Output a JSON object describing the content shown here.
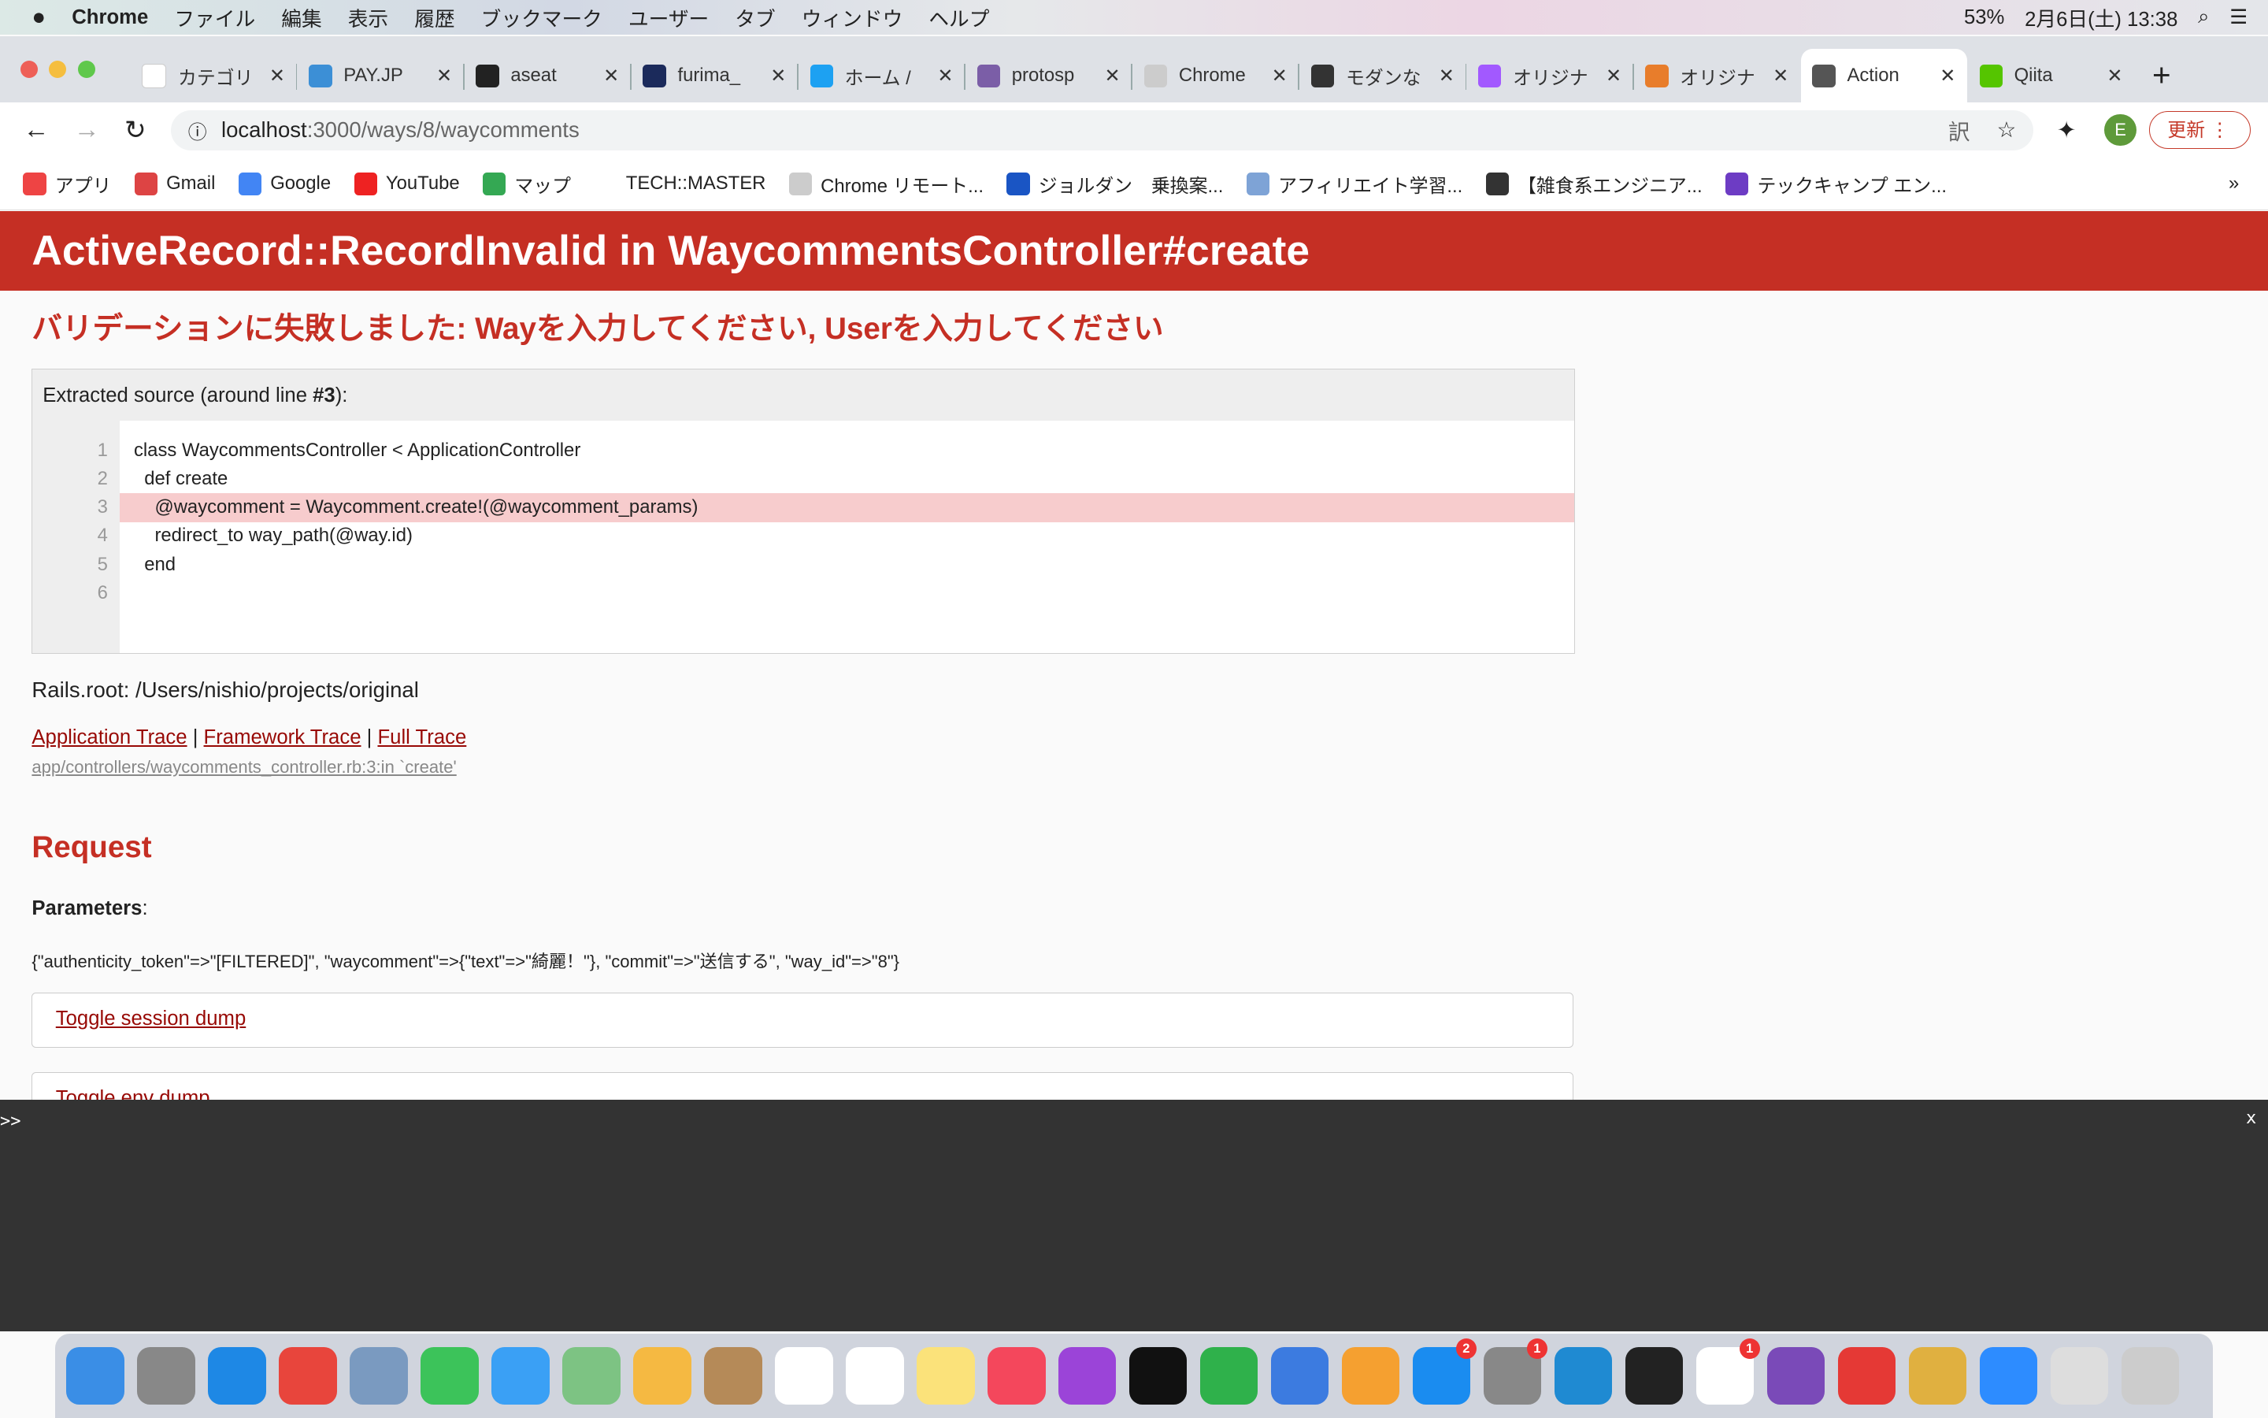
{
  "menubar": {
    "app": "Chrome",
    "items": [
      "ファイル",
      "編集",
      "表示",
      "履歴",
      "ブックマーク",
      "ユーザー",
      "タブ",
      "ウィンドウ",
      "ヘルプ"
    ],
    "battery": "53%",
    "clock": "2月6日(土) 13:38"
  },
  "tabs": [
    {
      "label": "カテゴリ",
      "color": "#fff"
    },
    {
      "label": "PAY.JP",
      "color": "#3c8fd6"
    },
    {
      "label": "aseat",
      "color": "#222"
    },
    {
      "label": "furima_",
      "color": "#1b2a5b"
    },
    {
      "label": "ホーム /",
      "color": "#1da1f2"
    },
    {
      "label": "protosp",
      "color": "#7b5ea7"
    },
    {
      "label": "Chrome",
      "color": "#ccc"
    },
    {
      "label": "モダンな",
      "color": "#333"
    },
    {
      "label": "オリジナ",
      "color": "#a259ff"
    },
    {
      "label": "オリジナ",
      "color": "#e87d2b"
    },
    {
      "label": "Action",
      "color": "#555",
      "active": true
    },
    {
      "label": "Qiita",
      "color": "#55c500"
    }
  ],
  "address": {
    "host": "localhost",
    "path": ":3000/ways/8/waycomments"
  },
  "profile_initial": "E",
  "update_label": "更新",
  "bookmarks": [
    {
      "label": "アプリ",
      "color": "#e44"
    },
    {
      "label": "Gmail",
      "color": "#d44"
    },
    {
      "label": "Google",
      "color": "#4285f4"
    },
    {
      "label": "YouTube",
      "color": "#e22"
    },
    {
      "label": "マップ",
      "color": "#34a853"
    },
    {
      "label": "TECH::MASTER",
      "color": "#fff"
    },
    {
      "label": "Chrome リモート...",
      "color": "#ccc"
    },
    {
      "label": "ジョルダン　乗換案...",
      "color": "#1a55c4"
    },
    {
      "label": "アフィリエイト学習...",
      "color": "#7ea3d6"
    },
    {
      "label": "【雑食系エンジニア...",
      "color": "#333"
    },
    {
      "label": "テックキャンプ エン...",
      "color": "#6d3cc4"
    }
  ],
  "error": {
    "title": "ActiveRecord::RecordInvalid in WaycommentsController#create",
    "message": "バリデーションに失敗しました: Wayを入力してください, Userを入力してください",
    "source_caption_pre": "Extracted source (around line ",
    "source_caption_line": "#3",
    "source_caption_post": "):",
    "lines": [
      {
        "n": "1",
        "code": "class WaycommentsController < ApplicationController"
      },
      {
        "n": "2",
        "code": "  def create"
      },
      {
        "n": "3",
        "code": "    @waycomment = Waycomment.create!(@waycomment_params)",
        "hl": true
      },
      {
        "n": "4",
        "code": "    redirect_to way_path(@way.id)"
      },
      {
        "n": "5",
        "code": "  end"
      },
      {
        "n": "6",
        "code": ""
      }
    ],
    "rails_root": "Rails.root: /Users/nishio/projects/original",
    "trace_links": [
      "Application Trace",
      "Framework Trace",
      "Full Trace"
    ],
    "trace_line": "app/controllers/waycomments_controller.rb:3:in `create'",
    "request_heading": "Request",
    "params_label": "Parameters",
    "params": "{\"authenticity_token\"=>\"[FILTERED]\", \"waycomment\"=>{\"text\"=>\"綺麗！\"}, \"commit\"=>\"送信する\", \"way_id\"=>\"8\"}",
    "toggle_session": "Toggle session dump",
    "toggle_env": "Toggle env dump"
  },
  "console": {
    "prompt": ">>",
    "close": "x"
  },
  "dock": [
    {
      "name": "finder",
      "color": "#3a8ee6"
    },
    {
      "name": "launchpad",
      "color": "#888"
    },
    {
      "name": "safari",
      "color": "#1e88e5"
    },
    {
      "name": "chrome",
      "color": "#e8453c"
    },
    {
      "name": "preview",
      "color": "#7a9ac0"
    },
    {
      "name": "facetime",
      "color": "#3cc35a"
    },
    {
      "name": "messages",
      "color": "#3aa0f5"
    },
    {
      "name": "maps",
      "color": "#7dc383"
    },
    {
      "name": "photos",
      "color": "#f5b942"
    },
    {
      "name": "contacts",
      "color": "#b58a58"
    },
    {
      "name": "calendar",
      "color": "#fff"
    },
    {
      "name": "reminders",
      "color": "#fff"
    },
    {
      "name": "notes",
      "color": "#fbe27a"
    },
    {
      "name": "music",
      "color": "#f4475c"
    },
    {
      "name": "podcasts",
      "color": "#9b44d8"
    },
    {
      "name": "tv",
      "color": "#111"
    },
    {
      "name": "numbers",
      "color": "#2fb14b"
    },
    {
      "name": "keynote",
      "color": "#3c7be0"
    },
    {
      "name": "pages",
      "color": "#f5a030"
    },
    {
      "name": "app-store",
      "color": "#1a8cf0",
      "badge": "2"
    },
    {
      "name": "system-preferences",
      "color": "#888",
      "badge": "1"
    },
    {
      "name": "vscode",
      "color": "#1f8ad2"
    },
    {
      "name": "terminal",
      "color": "#222"
    },
    {
      "name": "slack",
      "color": "#fff",
      "badge": "1"
    },
    {
      "name": "github-desktop",
      "color": "#7a4ab8"
    },
    {
      "name": "mail",
      "color": "#e53935"
    },
    {
      "name": "sequel-pro",
      "color": "#e0b040"
    },
    {
      "name": "zoom",
      "color": "#2d8cff"
    },
    {
      "name": "downloads",
      "color": "#ddd"
    },
    {
      "name": "trash",
      "color": "#ccc"
    }
  ]
}
